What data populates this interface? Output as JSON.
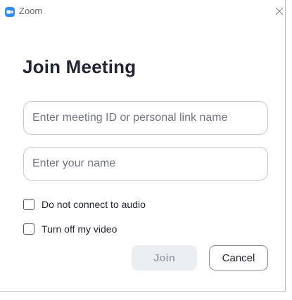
{
  "window": {
    "title": "Zoom"
  },
  "dialog": {
    "heading": "Join Meeting",
    "meeting_id_field": {
      "value": "",
      "placeholder": "Enter meeting ID or personal link name"
    },
    "name_field": {
      "value": "",
      "placeholder": "Enter your name"
    },
    "options": [
      {
        "label": "Do not connect to audio",
        "checked": false
      },
      {
        "label": "Turn off my video",
        "checked": false
      }
    ],
    "join_label": "Join",
    "cancel_label": "Cancel"
  },
  "icons": {
    "app": "zoom-camera-icon",
    "close": "close-icon"
  },
  "colors": {
    "brand": "#2d8cff",
    "heading": "#232333",
    "join_disabled_bg": "#ededf4",
    "join_disabled_text": "#a6a6b2"
  }
}
